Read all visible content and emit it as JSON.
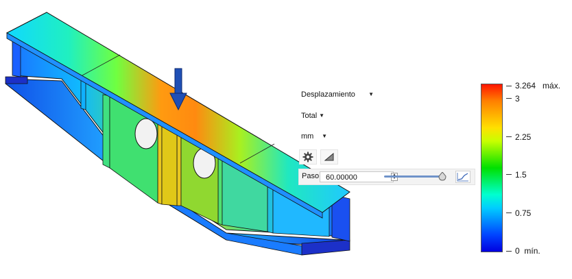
{
  "controls": {
    "result_type": "Desplazamiento",
    "component": "Total",
    "unit": "mm",
    "settings_icon": "gear-icon",
    "clip_icon": "triangle-icon",
    "step": {
      "label": "Paso",
      "value": "60.00000",
      "slider_fraction": 1.0,
      "graph_icon": "line-graph-icon"
    }
  },
  "legend": {
    "max_value": "3.264",
    "max_suffix": "máx.",
    "min_value": "0",
    "min_suffix": "mín.",
    "labels": [
      "3",
      "2.25",
      "1.5",
      "0.75"
    ],
    "colors": {
      "high": "#ff1500",
      "mid_high": "#ffe000",
      "mid": "#00e000",
      "mid_low": "#00ffd0",
      "low": "#0000e0"
    }
  },
  "viewport": {
    "load_arrow_color": "#1f4fb5"
  }
}
